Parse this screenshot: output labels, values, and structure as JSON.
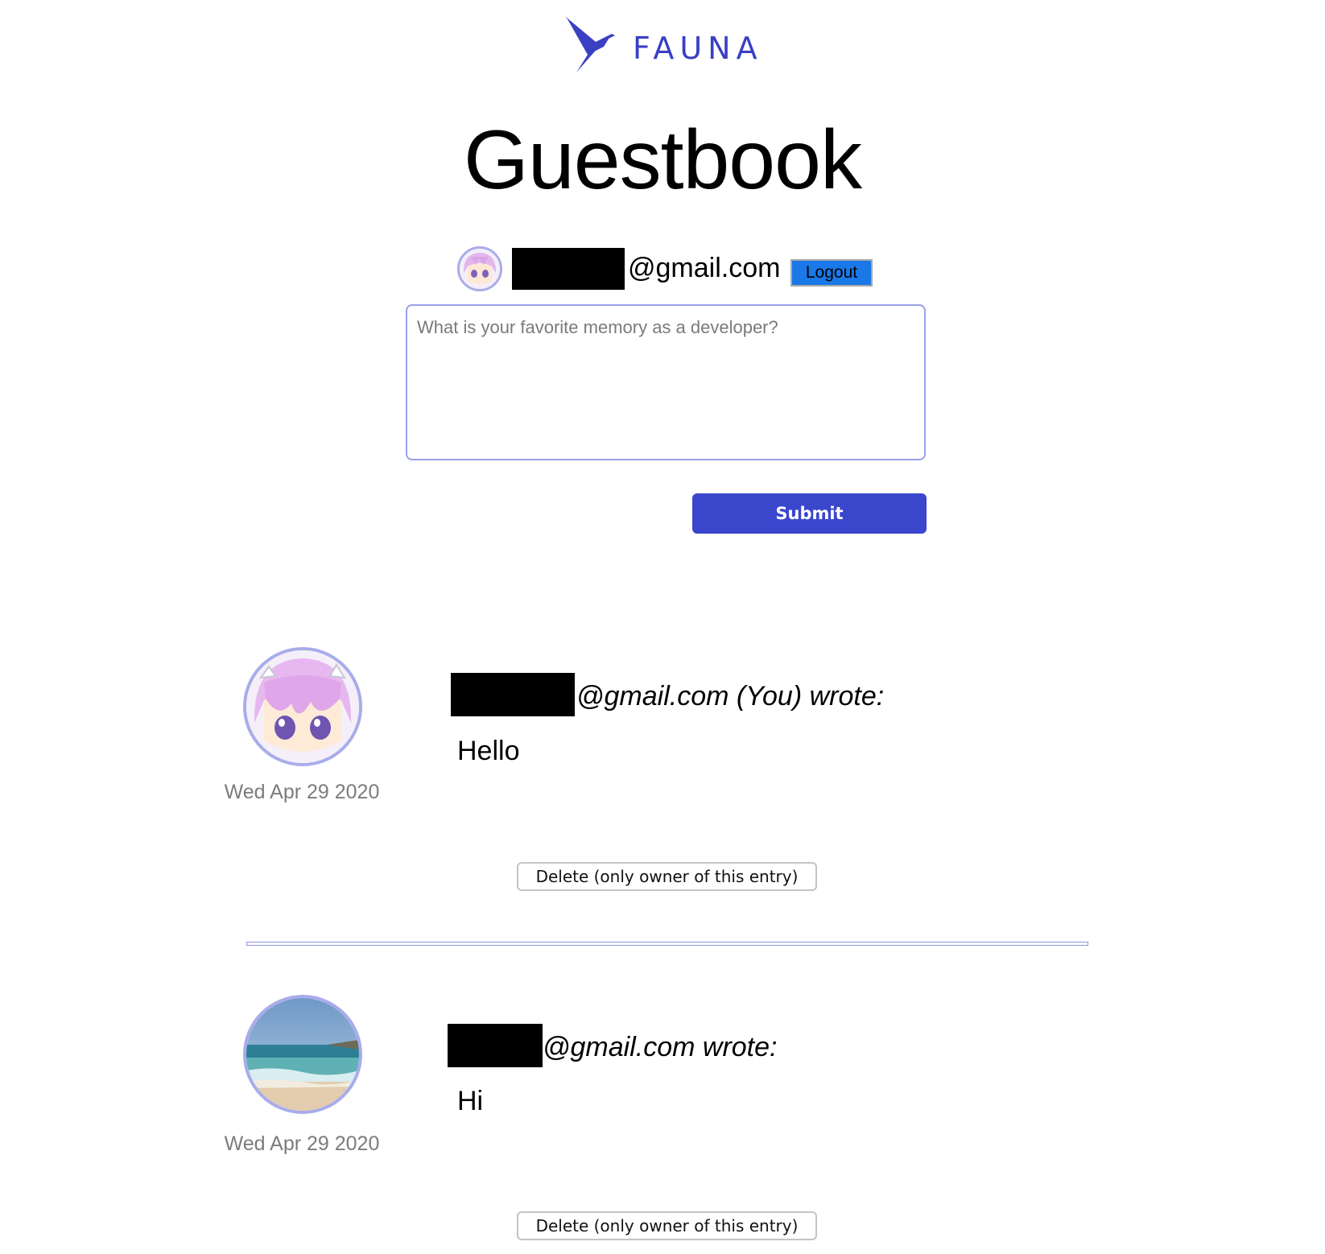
{
  "brand": {
    "name": "FAUNA",
    "color": "#3a3fc4"
  },
  "page": {
    "title": "Guestbook"
  },
  "user": {
    "email_suffix": "@gmail.com",
    "logout_label": "Logout"
  },
  "composer": {
    "placeholder": "What is your favorite memory as a developer?",
    "submit_label": "Submit",
    "accent": "#3a46cc"
  },
  "entries": [
    {
      "author_suffix": "@gmail.com (You) wrote:",
      "message": "Hello",
      "date": "Wed Apr 29 2020",
      "avatar": "anime-character-avatar",
      "delete_label": "Delete (only owner of this entry)"
    },
    {
      "author_suffix": "@gmail.com wrote:",
      "message": "Hi",
      "date": "Wed Apr 29 2020",
      "avatar": "beach-photo-avatar",
      "delete_label": "Delete (only owner of this entry)"
    }
  ]
}
